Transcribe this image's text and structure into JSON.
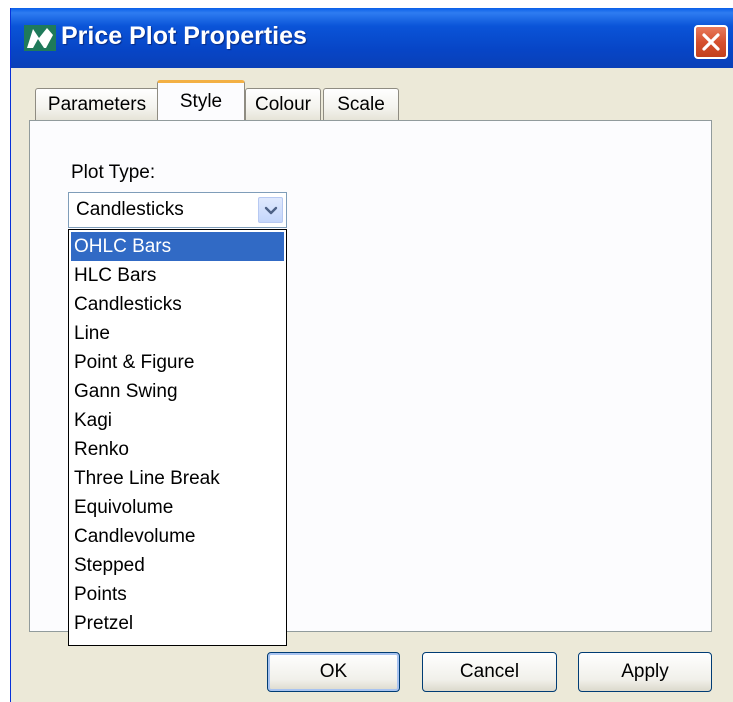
{
  "window": {
    "title": "Price Plot Properties",
    "title_color": "#ffffff",
    "titlebar_color": "#0a54d8"
  },
  "tabs": [
    {
      "label": "Parameters",
      "active": false
    },
    {
      "label": "Style",
      "active": true
    },
    {
      "label": "Colour",
      "active": false
    },
    {
      "label": "Scale",
      "active": false
    }
  ],
  "style_tab": {
    "plot_type_label": "Plot Type:",
    "plot_type_value": "Candlesticks",
    "options": [
      "OHLC Bars",
      "HLC Bars",
      "Candlesticks",
      "Line",
      "Point & Figure",
      "Gann Swing",
      "Kagi",
      "Renko",
      "Three Line Break",
      "Equivolume",
      "Candlevolume",
      "Stepped",
      "Points",
      "Pretzel"
    ],
    "highlighted_option": "OHLC Bars",
    "highlight_color": "#316ac5"
  },
  "buttons": {
    "ok": "OK",
    "cancel": "Cancel",
    "apply": "Apply"
  },
  "icons": {
    "app": "app-logo-icon",
    "close": "close-icon",
    "dropdown": "chevron-down-icon"
  }
}
